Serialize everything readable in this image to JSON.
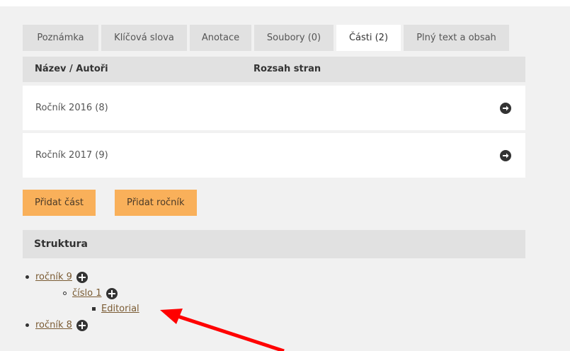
{
  "tabs": [
    {
      "label": "Poznámka",
      "active": false
    },
    {
      "label": "Klíčová slova",
      "active": false
    },
    {
      "label": "Anotace",
      "active": false
    },
    {
      "label": "Soubory (0)",
      "active": false
    },
    {
      "label": "Části (2)",
      "active": true
    },
    {
      "label": "Plný text a obsah",
      "active": false
    }
  ],
  "table": {
    "headers": [
      "Název / Autoři",
      "Rozsah stran"
    ],
    "rows": [
      {
        "label": "Ročník 2016 (8)",
        "icon": "arrow-right-circle-icon"
      },
      {
        "label": "Ročník 2017 (9)",
        "icon": "arrow-right-circle-icon"
      }
    ]
  },
  "buttons": {
    "add_part": "Přidat část",
    "add_volume": "Přidat ročník"
  },
  "structure": {
    "title": "Struktura",
    "tree": [
      {
        "label": "ročník 9",
        "level": 0
      },
      {
        "label": "číslo 1",
        "level": 1
      },
      {
        "label": "Editorial",
        "level": 2
      },
      {
        "label": "ročník 8",
        "level": 0
      }
    ]
  },
  "colors": {
    "accent_button": "#f9b05a",
    "annotation_arrow": "#ff0000",
    "link": "#7a5b33"
  }
}
